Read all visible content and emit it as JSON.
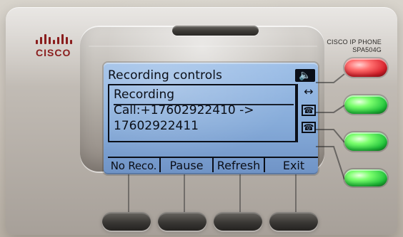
{
  "brand": {
    "name": "CISCO"
  },
  "device": {
    "model_line1": "CISCO IP PHONE",
    "model_line2": "SPA504G"
  },
  "screen": {
    "title": "Recording controls",
    "lines": [
      "Recording",
      "Call:+17602922410 ->",
      "17602922411"
    ],
    "softkeys": [
      "No Reco.",
      "Pause",
      "Refresh",
      "Exit"
    ],
    "icons": {
      "title_right": "speaker-icon",
      "side_top": "double-arrow-icon",
      "side_mid": "phone-icon",
      "side_bottom": "phone-icon"
    }
  },
  "colors": {
    "lcd_bg": "#86abd9",
    "lcd_text": "#0b0f18",
    "brand_red": "#8a1d1d",
    "led_red": "#d71f2a",
    "led_green": "#21c43b"
  }
}
